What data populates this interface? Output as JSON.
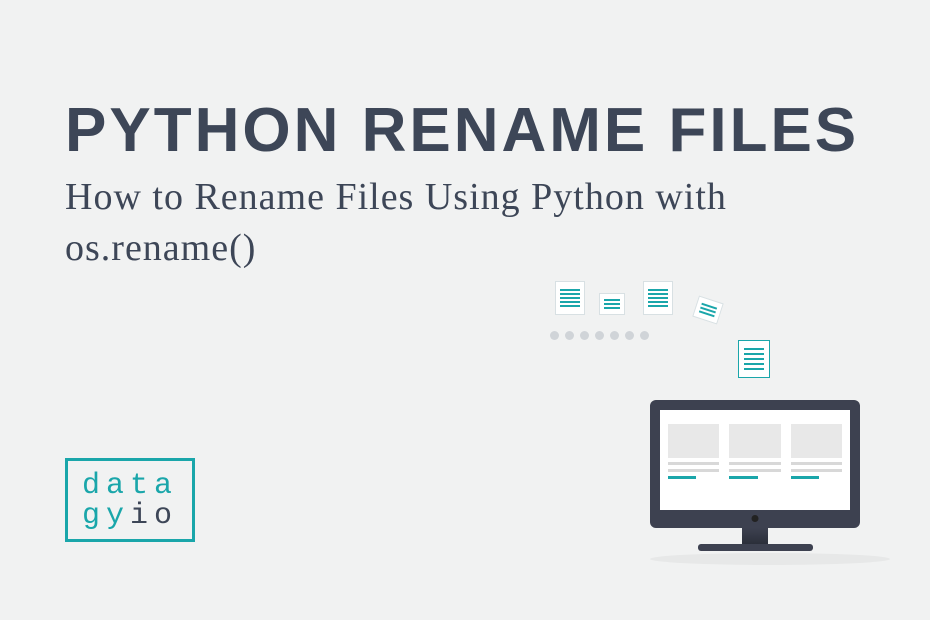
{
  "title": "PYTHON RENAME FILES",
  "subtitle": "How to Rename Files Using Python with os.rename()",
  "logo": {
    "line1_teal": "data",
    "line2_teal": "gy",
    "line2_gray": "io"
  },
  "colors": {
    "accent": "#1aa6aa",
    "heading": "#3d4657",
    "background": "#f1f2f2"
  }
}
